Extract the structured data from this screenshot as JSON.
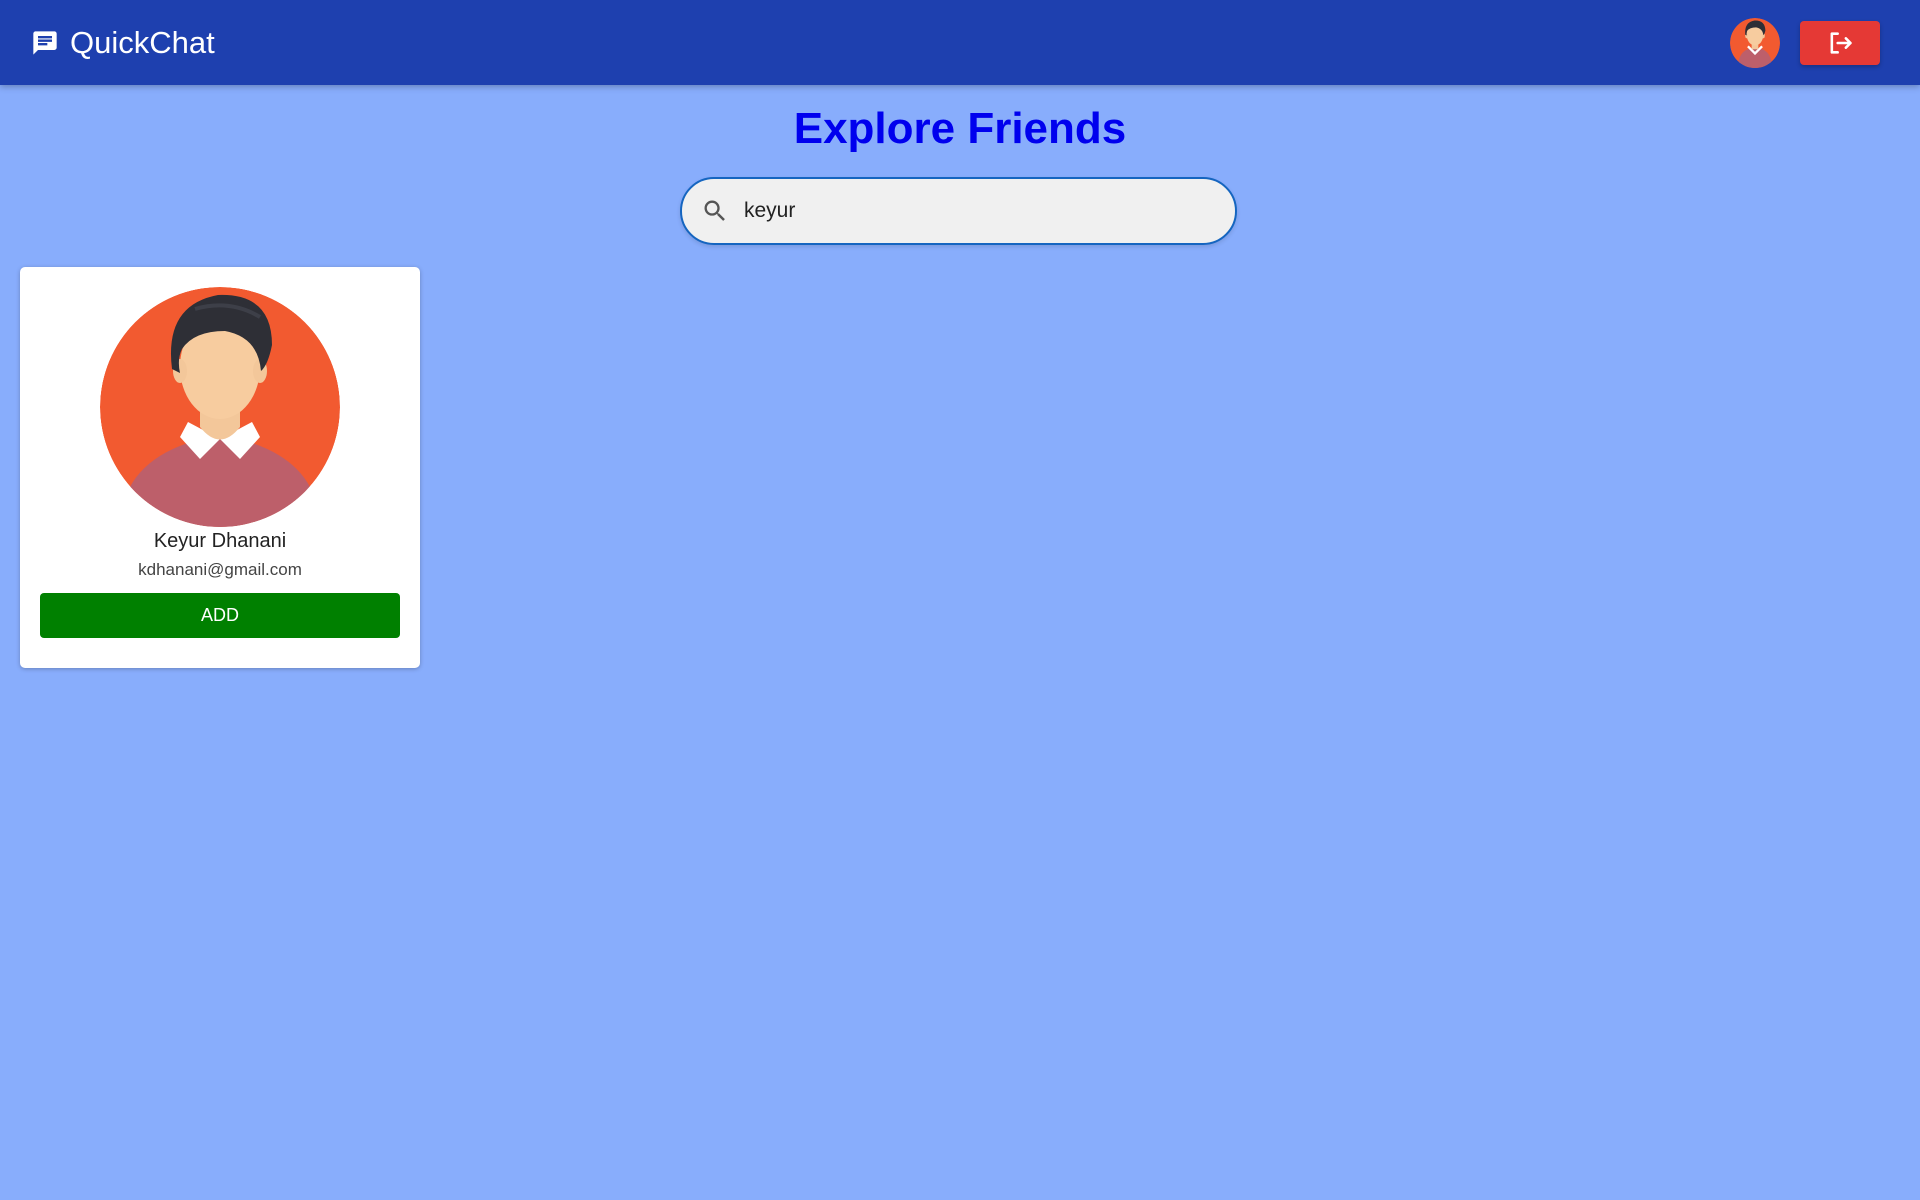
{
  "header": {
    "app_title": "QuickChat",
    "brand_icon": "chat-bubble-icon",
    "profile_avatar_icon": "user-avatar-icon",
    "logout_icon": "logout-icon",
    "color_appbar": "#1e40af",
    "color_logout": "#e53935"
  },
  "main": {
    "page_title": "Explore Friends",
    "search": {
      "value": "keyur",
      "icon": "search-icon"
    },
    "results": [
      {
        "name": "Keyur Dhanani",
        "email": "kdhanani@gmail.com",
        "action_label": "ADD"
      }
    ]
  },
  "colors": {
    "background": "#88adfc",
    "title": "#0000ee",
    "add_button": "#008000"
  }
}
